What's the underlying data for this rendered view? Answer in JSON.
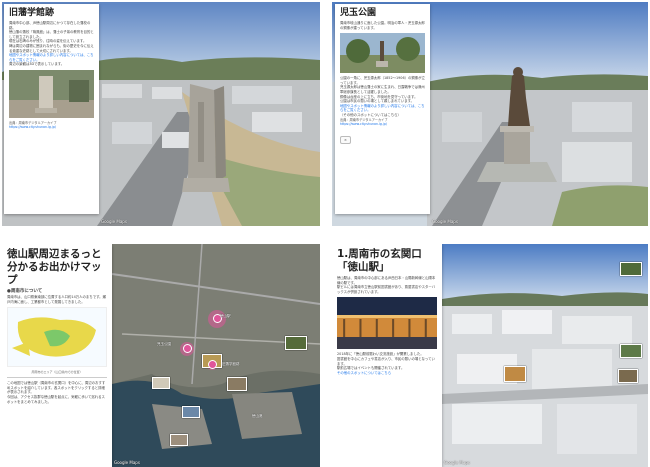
{
  "panels": [
    {
      "title": "旧藩学館跡",
      "body": "周南市中心部、JR徳山駅周辺にかつて存在した藩校の跡。\n徳山藩の藩校「鳴鳳館」は、藩士の子弟の教育を目的として設立されました。\n現在は石碑のみが残り、往時の姿を伝えています。\n碑は周辺の建物に囲まれながらも、街の歴史を今に伝える貴重な史跡として大切にされています。",
      "link_text": "地図やスポット情報のより詳しい内容については、こちらをご覧ください。",
      "body2": "周辺の景観は3Dで表示しています。",
      "caption": "",
      "source_label": "出典：周南市デジタルアーカイブ",
      "source_url": "https://www.city.shunan.lg.jp/",
      "close_label": "",
      "attribution": "Google Maps"
    },
    {
      "title": "児玉公園",
      "body": "周南市岐山通りに面した公園。明治の軍人・児玉源太郎の銅像が建っています。",
      "body2": "公園の一角に、児玉源太郎（1852〜1906）の銅像が立っています。\n児玉源太郎は徳山藩士の家に生まれ、日露戦争では満州軍総参謀長として活躍しました。\n銅像は台座の上に立ち、市街地を見守っています。\n公園は市民の憩いの場として親しまれています。",
      "link_text": "地図やスポット情報のより詳しい内容については、こちらをご覧ください。",
      "body3": "（その他のスポットについてはこちら）",
      "source_label": "出典：周南市デジタルアーカイブ",
      "source_url": "https://www.city.shunan.lg.jp/",
      "close_label": "×",
      "attribution": "Google Maps"
    },
    {
      "title": "徳山駅周辺まるっと分かるお出かけマップ",
      "section": "●周南市について",
      "body": "周南市は、山口県東南部に位置する人口約14万人のまちです。瀬戸内海に面し、工業都市として発展してきました。",
      "map_caption": "周南市のエリア（山口県内での位置）",
      "body2": "この地図では徳山駅（周南市の玄関口）を中心に、周辺のおすすめスポットを紹介しています。各スポットをクリックすると詳細が表示されます。",
      "body3": "今回は、アクセス抜群な徳山駅を起点に、気軽に歩いて巡れるスポットをまとめてみました。",
      "attribution": "Google Maps"
    },
    {
      "title": "1.周南市の玄関口「徳山駅」",
      "body": "徳山駅は、周南市の中心部にあるJR西日本・山陽新幹線と山陽本線の駅です。\n駅ビルには周南市立徳山駅前図書館があり、蔦屋書店やスターバックスが併設されています。",
      "body2": "2018年に「徳山駅前賑わい交流施設」が開業しました。\n図書館を中心にカフェや書店が入り、市民の憩いの場となっています。",
      "body3": "駅前広場ではイベントも開催されています。",
      "link_text": "その他のスポットについてはこちら",
      "attribution": "Google Maps"
    }
  ],
  "map_pois": [
    {
      "label": "徳山駅"
    },
    {
      "label": "児玉公園"
    },
    {
      "label": "旧藩学館跡"
    },
    {
      "label": "徳山港"
    }
  ],
  "colors": {
    "link": "#1a73e8",
    "pin": "#e0559a",
    "map_yellow": "#e8d84a",
    "map_green": "#7cc86a"
  }
}
